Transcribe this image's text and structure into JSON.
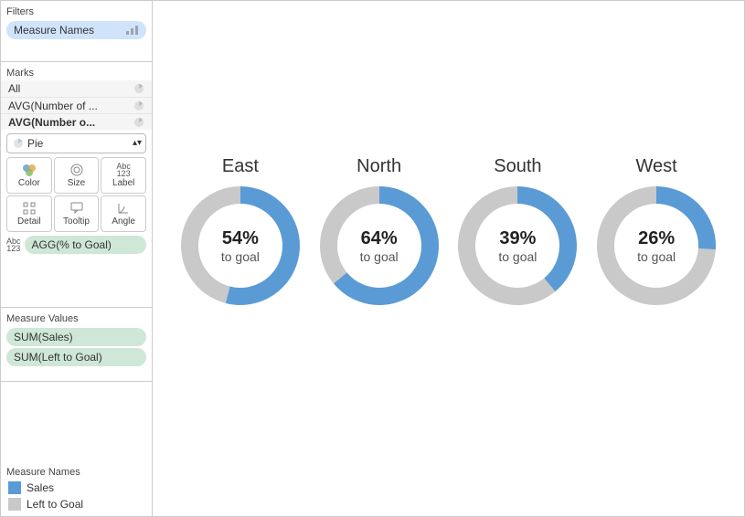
{
  "filters": {
    "header": "Filters",
    "pill": "Measure Names"
  },
  "marks": {
    "header": "Marks",
    "rows": [
      {
        "label": "All",
        "bold": false
      },
      {
        "label": "AVG(Number of ...",
        "bold": false
      },
      {
        "label": "AVG(Number o...",
        "bold": true
      }
    ],
    "mark_type": "Pie",
    "shelves_row1": [
      {
        "id": "color",
        "label": "Color"
      },
      {
        "id": "size",
        "label": "Size"
      },
      {
        "id": "label",
        "label": "Label"
      }
    ],
    "shelves_row2": [
      {
        "id": "detail",
        "label": "Detail"
      },
      {
        "id": "tooltip",
        "label": "Tooltip"
      },
      {
        "id": "angle",
        "label": "Angle"
      }
    ],
    "agg_pill": "AGG(% to Goal)"
  },
  "measure_values": {
    "header": "Measure Values",
    "items": [
      "SUM(Sales)",
      "SUM(Left to Goal)"
    ]
  },
  "legend": {
    "header": "Measure Names",
    "colors": {
      "Sales": "#5b9bd5",
      "Left to Goal": "#c9c9c9"
    },
    "items": [
      "Sales",
      "Left to Goal"
    ]
  },
  "chart_data": {
    "type": "pie",
    "subtype": "donut-multiples",
    "caption_suffix": "to goal",
    "series": [
      {
        "name": "East",
        "pct_to_goal": 54
      },
      {
        "name": "North",
        "pct_to_goal": 64
      },
      {
        "name": "South",
        "pct_to_goal": 39
      },
      {
        "name": "West",
        "pct_to_goal": 26
      }
    ],
    "colors": {
      "progress": "#5b9bd5",
      "remainder": "#c9c9c9"
    }
  }
}
